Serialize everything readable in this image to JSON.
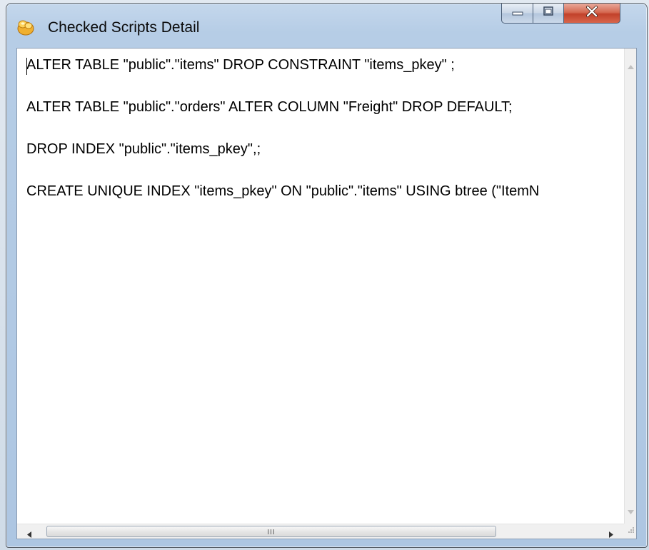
{
  "window": {
    "title": "Checked Scripts Detail",
    "icon": "app-logo-icon"
  },
  "title_buttons": {
    "minimize": "minimize-icon",
    "maximize": "maximize-icon",
    "close": "close-icon"
  },
  "content": {
    "lines": [
      "ALTER TABLE \"public\".\"items\" DROP CONSTRAINT \"items_pkey\" ;",
      "ALTER TABLE \"public\".\"orders\" ALTER COLUMN \"Freight\" DROP DEFAULT;",
      "DROP INDEX \"public\".\"items_pkey\",;",
      "CREATE UNIQUE INDEX \"items_pkey\" ON \"public\".\"items\" USING btree (\"ItemN"
    ]
  },
  "scrollbars": {
    "horizontal_grip": "III"
  },
  "colors": {
    "close_button": "#c2412a",
    "window_frame": "#b6cde6"
  }
}
